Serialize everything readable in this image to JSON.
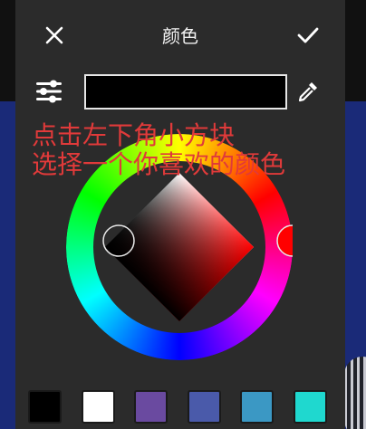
{
  "dialog": {
    "title": "颜色",
    "close_icon": "close-icon",
    "confirm_icon": "check-icon",
    "adjust_icon": "sliders-icon",
    "eyedropper_icon": "eyedropper-icon",
    "current_color": "#000000"
  },
  "overlay": {
    "line1": "点击左下角小方块",
    "line2": "选择一个你喜欢的颜色",
    "color": "#e03a3a"
  },
  "swatches": [
    "#000000",
    "#ffffff",
    "#6a4aa0",
    "#4a5aaa",
    "#3b98c4",
    "#1fd8cf"
  ]
}
